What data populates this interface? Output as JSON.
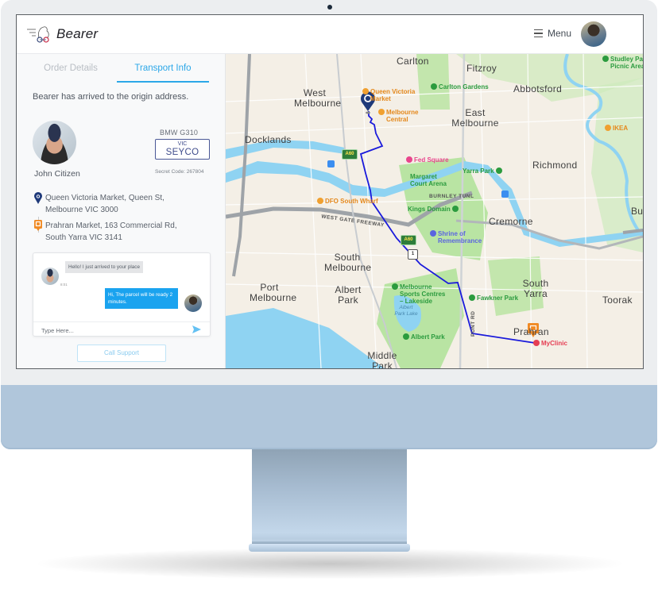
{
  "app": {
    "brand": "Bearer",
    "menu_label": "Menu",
    "icons": {
      "logo": "bear-bike-logo-icon",
      "menu": "hamburger-icon",
      "user": "user-avatar",
      "send": "send-icon",
      "origin": "origin-pin-icon",
      "destination": "destination-pin-icon"
    }
  },
  "tabs": [
    {
      "label": "Order Details",
      "active": false
    },
    {
      "label": "Transport Info",
      "active": true
    }
  ],
  "transport": {
    "status": "Bearer has arrived to the origin address.",
    "driver_name": "John Citizen",
    "vehicle_model": "BMW G310",
    "plate_state": "VIC",
    "plate_number": "SEYCO",
    "secret_code": "Secret Code: 267804",
    "origin": {
      "line1": "Queen Victoria Market, Queen St,",
      "line2": "Melbourne VIC 3000"
    },
    "destination": {
      "line1": "Prahran Market, 163 Commercial Rd,",
      "line2": "South Yarra VIC 3141"
    }
  },
  "chat": {
    "messages": [
      {
        "from": "driver",
        "text": "Hello! I just arrived to your place",
        "time": "8:01"
      },
      {
        "from": "user",
        "text": "Hi, The parcel will be ready 2 minutes."
      }
    ],
    "input_placeholder": "Type Here...",
    "call_support_label": "Call Support"
  },
  "map": {
    "suburbs": [
      "Carlton",
      "Fitzroy",
      "West Melbourne",
      "Abbotsford",
      "East Melbourne",
      "Docklands",
      "Richmond",
      "Cremorne",
      "South Melbourne",
      "Port Melbourne",
      "Albert Park",
      "South Yarra",
      "Toorak",
      "Prahran",
      "Middle Park",
      "Bu"
    ],
    "pois": {
      "qvm": "Queen Victoria Market",
      "melb_central": "Melbourne Central",
      "carlton_gardens": "Carlton Gardens",
      "studley": "Studley Park Picnic Area",
      "ikea": "IKEA",
      "fed_square": "Fed Square",
      "yarra_park": "Yarra Park",
      "mca": "Margaret Court Arena",
      "dfo": "DFO South Wharf",
      "kings_domain": "Kings Domain",
      "shrine": "Shrine of Remembrance",
      "msac": "Melbourne Sports Centres – Lakeside",
      "albert_park_lake": "Albert Park Lake",
      "albert_park": "Albert Park",
      "fawkner": "Fawkner Park",
      "myclinic": "MyClinic"
    },
    "roads": {
      "burnley": "BURNLEY TUNL",
      "westgate": "WEST GATE FREEWAY",
      "punt": "PUNT RD"
    },
    "shields": [
      "A60",
      "A60",
      "1"
    ],
    "colors": {
      "route": "#1a1adb",
      "origin_pin": "#1f3a7a",
      "destination_pin": "#f08a24",
      "water": "#8fd3f2",
      "park": "#b9e4a3",
      "land": "#f4efe6"
    }
  }
}
